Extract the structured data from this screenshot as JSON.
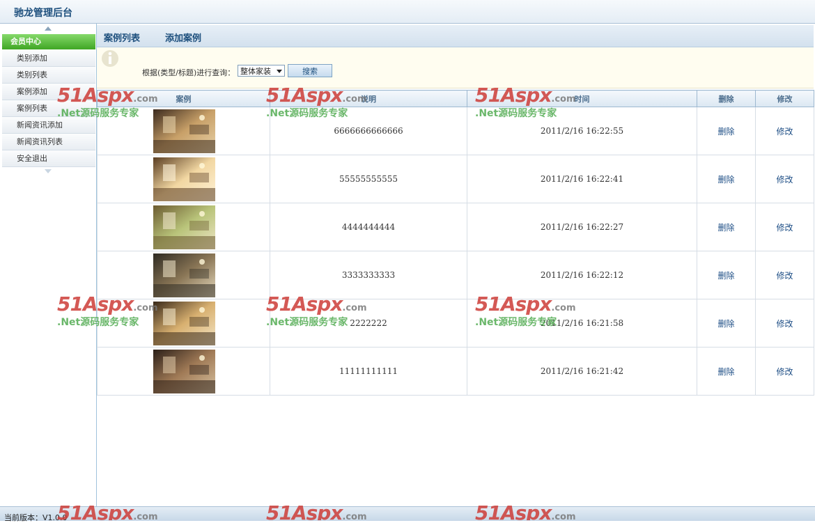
{
  "app": {
    "title": "驰龙管理后台"
  },
  "sidebar": {
    "header": "会员中心",
    "items": [
      {
        "label": "类别添加"
      },
      {
        "label": "类别列表"
      },
      {
        "label": "案例添加"
      },
      {
        "label": "案例列表"
      },
      {
        "label": "新闻资讯添加"
      },
      {
        "label": "新闻资讯列表"
      },
      {
        "label": "安全退出"
      }
    ]
  },
  "tabs": [
    {
      "label": "案例列表"
    },
    {
      "label": "添加案例"
    }
  ],
  "search": {
    "label": "根据(类型/标题)进行查询：",
    "selected": "整体家装",
    "button": "搜索"
  },
  "table": {
    "columns": [
      "案例",
      "说明",
      "时间",
      "删除",
      "修改"
    ],
    "rows": [
      {
        "description": "6666666666666",
        "time": "2011/2/16 16:22:55",
        "delete": "删除",
        "edit": "修改",
        "thumb_colors": [
          "#3b2a1e",
          "#c8a068",
          "#e8d2a8"
        ]
      },
      {
        "description": "55555555555",
        "time": "2011/2/16 16:22:41",
        "delete": "删除",
        "edit": "修改",
        "thumb_colors": [
          "#5a3d22",
          "#f2d7a2",
          "#fff3d8"
        ]
      },
      {
        "description": "4444444444",
        "time": "2011/2/16 16:22:27",
        "delete": "删除",
        "edit": "修改",
        "thumb_colors": [
          "#6b5a30",
          "#b9c47a",
          "#efe6c8"
        ]
      },
      {
        "description": "3333333333",
        "time": "2011/2/16 16:22:12",
        "delete": "删除",
        "edit": "修改",
        "thumb_colors": [
          "#2e2a22",
          "#8a7656",
          "#e8dcc0"
        ]
      },
      {
        "description": "2222222",
        "time": "2011/2/16 16:21:58",
        "delete": "删除",
        "edit": "修改",
        "thumb_colors": [
          "#3a2a1a",
          "#d8b070",
          "#f4e6c6"
        ]
      },
      {
        "description": "11111111111",
        "time": "2011/2/16 16:21:42",
        "delete": "删除",
        "edit": "修改",
        "thumb_colors": [
          "#2b1f18",
          "#a07a56",
          "#d8c2a0"
        ]
      }
    ]
  },
  "footer": {
    "version": "当前版本：V1.0.0"
  },
  "watermark": {
    "logo": "51Aspx",
    "domain": ".com",
    "slogan": ".Net源码服务专家"
  }
}
